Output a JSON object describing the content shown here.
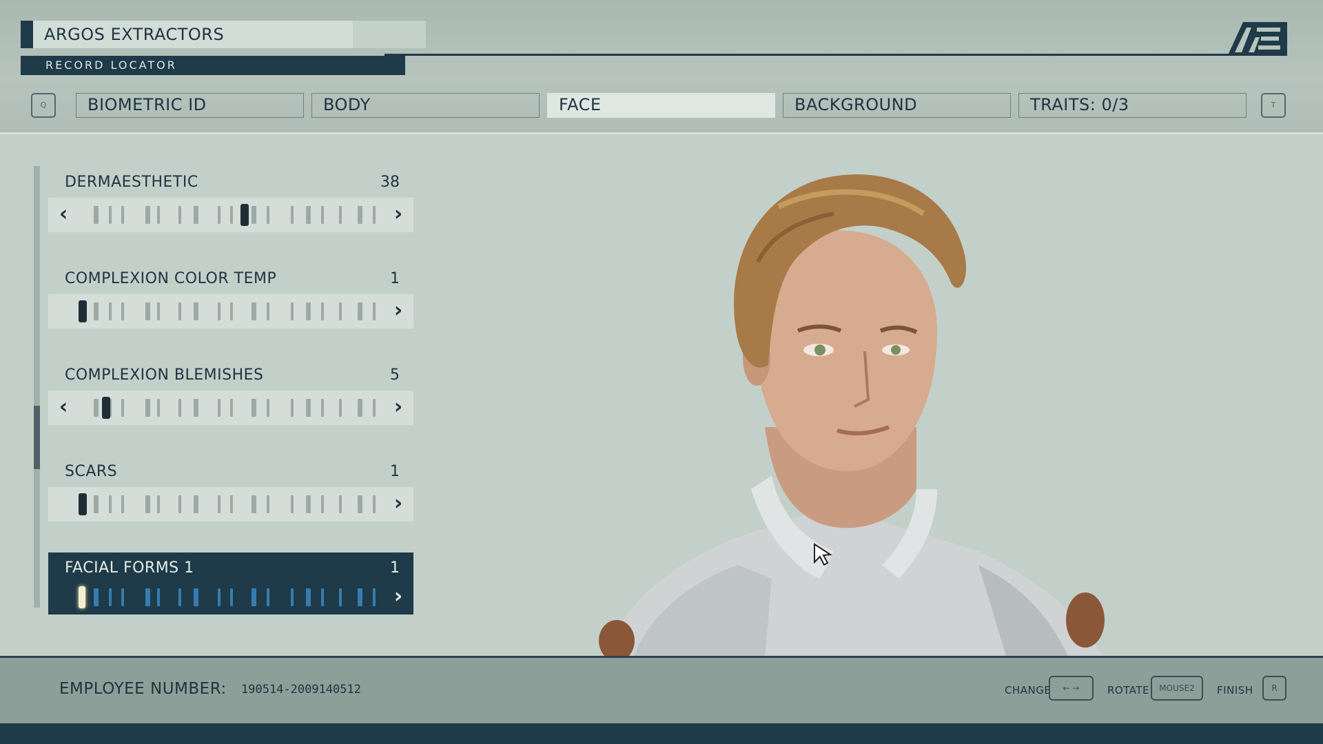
{
  "header": {
    "company": "ARGOS EXTRACTORS",
    "record_locator": "RECORD LOCATOR",
    "logo": "AE"
  },
  "tabs": {
    "prev_key": "Q",
    "next_key": "T",
    "items": [
      {
        "label": "BIOMETRIC ID",
        "active": false
      },
      {
        "label": "BODY",
        "active": false
      },
      {
        "label": "FACE",
        "active": true
      },
      {
        "label": "BACKGROUND",
        "active": false
      },
      {
        "label": "TRAITS: 0/3",
        "active": false
      }
    ]
  },
  "sliders": [
    {
      "label": "DERMAESTHETIC",
      "value": "38",
      "level": 0.55,
      "has_left": true
    },
    {
      "label": "COMPLEXION COLOR TEMP",
      "value": "1",
      "level": 0.0,
      "has_left": false
    },
    {
      "label": "COMPLEXION BLEMISHES",
      "value": "5",
      "level": 0.08,
      "has_left": true
    },
    {
      "label": "SCARS",
      "value": "1",
      "level": 0.0,
      "has_left": false
    },
    {
      "label": "FACIAL FORMS 1",
      "value": "1",
      "level": 0.0,
      "has_left": false,
      "selected": true
    }
  ],
  "footer": {
    "employee_label": "EMPLOYEE NUMBER:",
    "employee_number": "190514-2009140512",
    "hints": [
      {
        "label": "CHANGE",
        "key": "← →"
      },
      {
        "label": "ROTATE",
        "key": "MOUSE2"
      },
      {
        "label": "FINISH",
        "key": "R"
      }
    ]
  },
  "colors": {
    "navy": "#1f3a48",
    "panel": "#c3d0c9",
    "accent_blue": "#3b8fcb"
  },
  "icons": {
    "left_arrow": "chevron-left-icon",
    "right_arrow": "chevron-right-icon",
    "cursor": "mouse-cursor-icon"
  }
}
